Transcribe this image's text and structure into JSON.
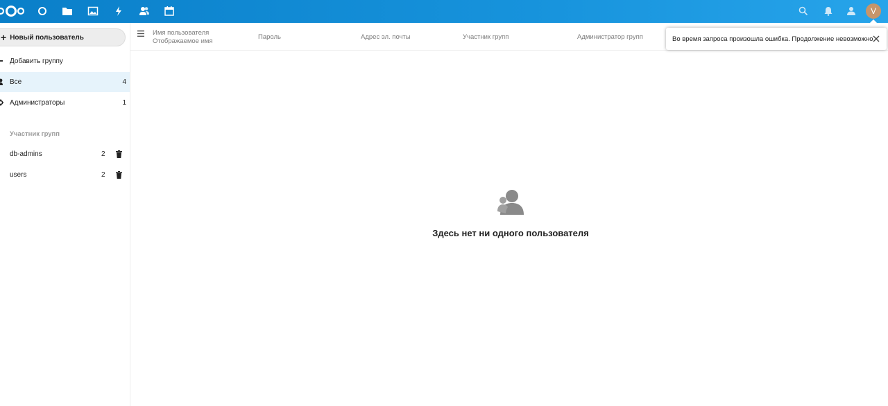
{
  "header": {
    "apps": [
      {
        "name": "dashboard",
        "icon": "circle-icon"
      },
      {
        "name": "files",
        "icon": "folder-icon"
      },
      {
        "name": "photos",
        "icon": "image-icon"
      },
      {
        "name": "activity",
        "icon": "lightning-icon"
      },
      {
        "name": "contacts",
        "icon": "contacts-icon"
      },
      {
        "name": "calendar",
        "icon": "calendar-icon"
      }
    ],
    "avatar_letter": "V",
    "colors": {
      "bar": "#0a7fc9",
      "bar_end": "#27a4ea",
      "avatar": "#c7956a"
    }
  },
  "sidebar": {
    "new_user_label": "Новый пользователь",
    "new_user_plus": "+",
    "add_group_label": "Добавить группу",
    "items": [
      {
        "label": "Все",
        "count": "4"
      },
      {
        "label": "Администраторы",
        "count": "1"
      }
    ],
    "groups_caption": "Участник групп",
    "groups": [
      {
        "label": "db-admins",
        "count": "2"
      },
      {
        "label": "users",
        "count": "2"
      }
    ]
  },
  "table": {
    "columns": {
      "username": "Имя пользователя",
      "display_name": "Отображаемое имя",
      "password": "Пароль",
      "email": "Адрес эл. почты",
      "groups": "Участник групп",
      "group_admin": "Администратор групп"
    }
  },
  "empty_state": {
    "text": "Здесь нет ни одного пользователя"
  },
  "toast": {
    "message": "Во время запроса произошла ошибка. Продолжение невозможно"
  }
}
